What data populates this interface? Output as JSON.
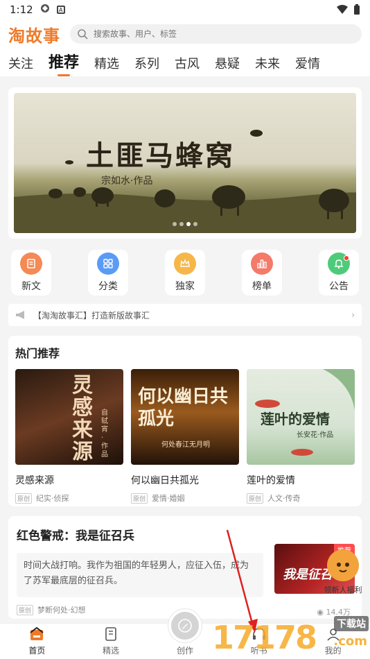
{
  "status": {
    "time": "1:12"
  },
  "header": {
    "logo_main": "淘故事",
    "search_placeholder": "搜索故事、用户、标签"
  },
  "tabs": [
    "关注",
    "推荐",
    "精选",
    "系列",
    "古风",
    "悬疑",
    "未来",
    "爱情"
  ],
  "banner": {
    "title": "土匪马蜂窝",
    "subtitle": "宗如水·作品"
  },
  "quick": [
    {
      "label": "新文",
      "icon": "document-icon",
      "color": "#f48a55"
    },
    {
      "label": "分类",
      "icon": "grid-icon",
      "color": "#5a9bf6"
    },
    {
      "label": "独家",
      "icon": "crown-icon",
      "color": "#f6b74a"
    },
    {
      "label": "榜单",
      "icon": "chart-icon",
      "color": "#f47a6a"
    },
    {
      "label": "公告",
      "icon": "bell-icon",
      "color": "#4ecb7a"
    }
  ],
  "notice": {
    "text": "【淘淘故事汇】打造新版故事汇"
  },
  "hot": {
    "title": "热门推荐",
    "books": [
      {
        "name": "灵感来源",
        "tag": "原创",
        "genre": "纪实·侦探",
        "cover_text": "灵感来源",
        "cover_sub": "自轼宵·作品"
      },
      {
        "name": "何以幽日共孤光",
        "tag": "原创",
        "genre": "爱情·婚姻",
        "cover_text": "何以幽日共孤光",
        "cover_sub": "何处春江无月明"
      },
      {
        "name": "莲叶的爱情",
        "tag": "原创",
        "genre": "人文·传奇",
        "cover_text": "莲叶的爱情",
        "cover_sub": "长安花·作品"
      }
    ]
  },
  "story": {
    "title": "红色警戒：我是征召兵",
    "body": "时间大战打响。我作为祖国的年轻男人，应征入伍，成为了苏军最底层的征召兵。",
    "tag": "原创",
    "author": "梦断何处·幻想",
    "badge": "推荐",
    "cover_text": "我是征召",
    "views": "14.4万"
  },
  "newbie": {
    "label": "领新人福利"
  },
  "bottom_nav": [
    {
      "label": "首页",
      "icon": "home-icon"
    },
    {
      "label": "精选",
      "icon": "book-icon"
    },
    {
      "label": "创作",
      "icon": "pen-icon"
    },
    {
      "label": "听书",
      "icon": "headphone-icon"
    },
    {
      "label": "我的",
      "icon": "user-icon"
    }
  ],
  "watermark": {
    "text": "17178",
    "sub": "下载站",
    "domain": ".com"
  }
}
